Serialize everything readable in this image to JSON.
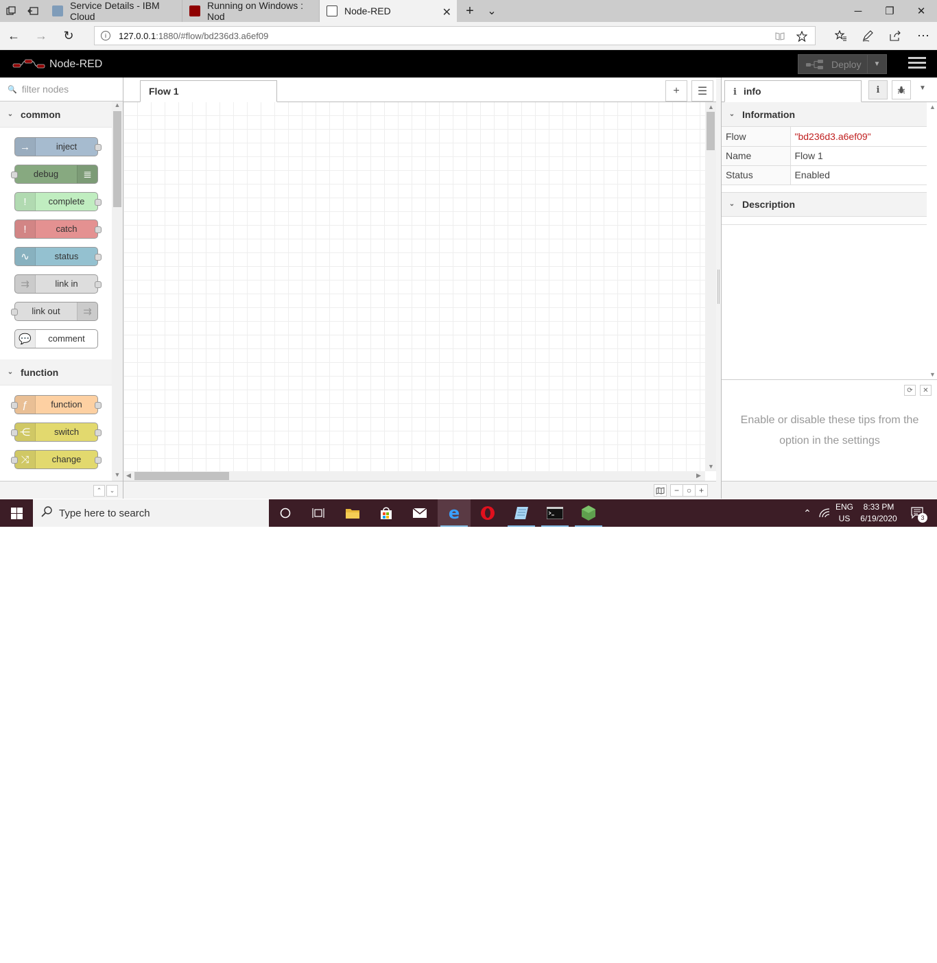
{
  "browser": {
    "tabs": [
      {
        "label": "Service Details - IBM Cloud",
        "favicon_color": "#7f9cb9"
      },
      {
        "label": "Running on Windows : Nod",
        "favicon_color": "#8f0000"
      },
      {
        "label": "Node-RED",
        "favicon_color": "#ffffff",
        "active": true
      }
    ],
    "close_glyph": "✕",
    "new_tab_glyph": "+",
    "tab_list_glyph": "⌄",
    "window_controls": {
      "minimize": "─",
      "restore": "❐",
      "close": "✕"
    },
    "address_host": "127.0.0.1",
    "address_rest": ":1880/#flow/bd236d3.a6ef09",
    "nav": {
      "back": "←",
      "forward": "→",
      "refresh": "↻"
    },
    "toolbar_icons": [
      "reading-view-icon",
      "favorite-star-icon",
      "favorites-hub-icon",
      "pen-icon",
      "share-icon",
      "more-icon"
    ]
  },
  "nodered": {
    "title": "Node-RED",
    "deploy_label": "Deploy",
    "palette": {
      "search_placeholder": "filter nodes",
      "categories": [
        {
          "name": "common",
          "nodes": [
            {
              "label": "inject",
              "color": "#a6bbcf",
              "icon_side": "left",
              "icon": "→",
              "in": false,
              "out": true
            },
            {
              "label": "debug",
              "color": "#87a980",
              "icon_side": "right",
              "icon": "≣",
              "in": true,
              "out": false
            },
            {
              "label": "complete",
              "color": "#c0edc0",
              "icon_side": "left",
              "icon": "!",
              "in": false,
              "out": true
            },
            {
              "label": "catch",
              "color": "#e49191",
              "icon_side": "left",
              "icon": "!",
              "in": false,
              "out": true
            },
            {
              "label": "status",
              "color": "#94c1d0",
              "icon_side": "left",
              "icon": "∿",
              "in": false,
              "out": true
            },
            {
              "label": "link in",
              "color": "#dddddd",
              "icon_side": "left",
              "icon": "⇉",
              "in": false,
              "out": true
            },
            {
              "label": "link out",
              "color": "#dddddd",
              "icon_side": "right",
              "icon": "⇉",
              "in": true,
              "out": false
            },
            {
              "label": "comment",
              "color": "#ffffff",
              "icon_side": "left",
              "icon": "💬",
              "in": false,
              "out": false
            }
          ]
        },
        {
          "name": "function",
          "nodes": [
            {
              "label": "function",
              "color": "#fdd0a2",
              "icon_side": "left",
              "icon": "ƒ",
              "in": true,
              "out": true
            },
            {
              "label": "switch",
              "color": "#e2d96e",
              "icon_side": "left",
              "icon": "⋲",
              "in": true,
              "out": true
            },
            {
              "label": "change",
              "color": "#e2d96e",
              "icon_side": "left",
              "icon": "⤨",
              "in": true,
              "out": true
            }
          ]
        }
      ]
    },
    "workspace": {
      "tab_label": "Flow 1",
      "add_glyph": "+",
      "list_glyph": "☰",
      "footer": {
        "map_glyph": "▯",
        "zoom_out": "−",
        "zoom_reset": "○",
        "zoom_in": "+"
      }
    },
    "sidebar": {
      "tab_label": "info",
      "info_glyph": "i",
      "debug_glyph": "✱",
      "information_header": "Information",
      "rows": [
        {
          "key": "Flow",
          "value": "\"bd236d3.a6ef09\"",
          "string": true
        },
        {
          "key": "Name",
          "value": "Flow 1",
          "string": false
        },
        {
          "key": "Status",
          "value": "Enabled",
          "string": false
        }
      ],
      "description_header": "Description",
      "tip_text": "Enable or disable these tips from the option in the settings",
      "tip_refresh_glyph": "⟳",
      "tip_close_glyph": "✕"
    }
  },
  "taskbar": {
    "search_placeholder": "Type here to search",
    "apps": [
      "cortana-icon",
      "task-view-icon",
      "file-explorer-icon",
      "store-icon",
      "mail-icon",
      "edge-icon",
      "opera-icon",
      "notepad-icon",
      "terminal-icon",
      "nodejs-icon"
    ],
    "lang_top": "ENG",
    "lang_bottom": "US",
    "time": "8:33 PM",
    "date": "6/19/2020",
    "notification_count": "3"
  },
  "colors": {
    "header_bg": "#000000",
    "taskbar_bg": "#3c1d26",
    "string_value": "#c02020"
  }
}
